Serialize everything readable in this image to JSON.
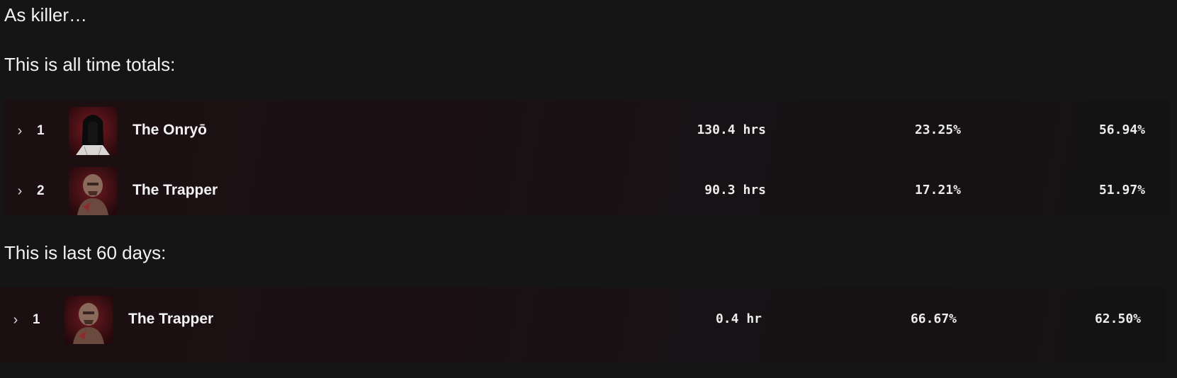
{
  "intro": "As killer…",
  "sections": [
    {
      "heading": "This is all time totals:",
      "rows": [
        {
          "expand_glyph": "›",
          "rank": "1",
          "killer": "The Onryō",
          "portrait_icon": "onryo-portrait-icon",
          "time": "130.4 hrs",
          "pick_rate": "23.25%",
          "win_rate": "56.94%"
        },
        {
          "expand_glyph": "›",
          "rank": "2",
          "killer": "The Trapper",
          "portrait_icon": "trapper-portrait-icon",
          "time": "90.3 hrs",
          "pick_rate": "17.21%",
          "win_rate": "51.97%"
        }
      ]
    },
    {
      "heading": "This is last 60 days:",
      "rows": [
        {
          "expand_glyph": "›",
          "rank": "1",
          "killer": "The Trapper",
          "portrait_icon": "trapper-portrait-icon",
          "time": "0.4 hr",
          "pick_rate": "66.67%",
          "win_rate": "62.50%"
        }
      ]
    }
  ],
  "colors": {
    "page_background": "#151516",
    "table_background": "#1a1013",
    "text": "#f1f1f1"
  }
}
